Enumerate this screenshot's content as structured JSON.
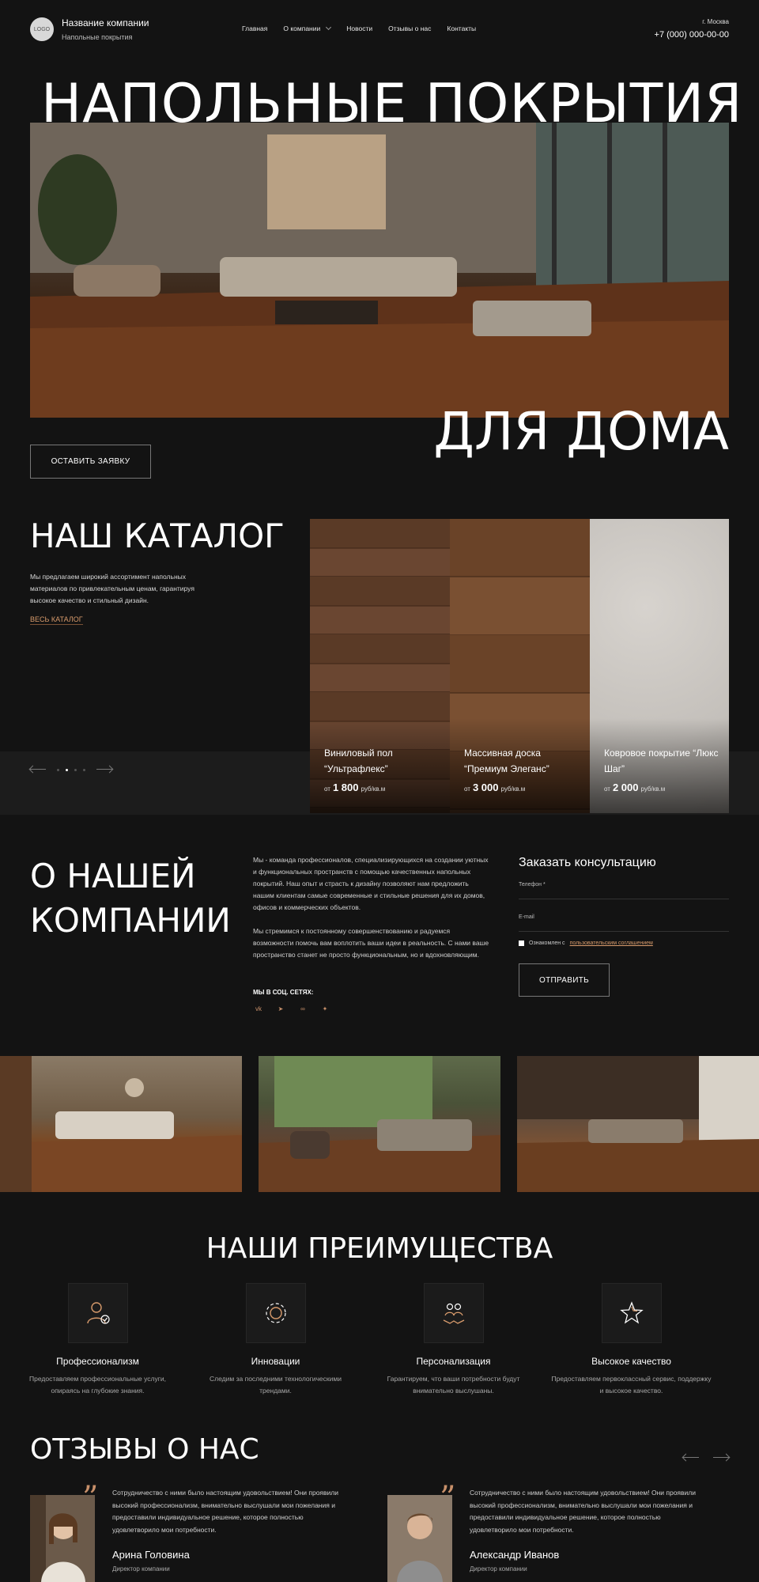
{
  "header": {
    "logo_text": "LOGO",
    "company_name": "Название компании",
    "company_sub": "Напольные покрытия",
    "nav": [
      "Главная",
      "О компании",
      "Новости",
      "Отзывы о нас",
      "Контакты"
    ],
    "city": "г. Москва",
    "phone": "+7 (000) 000-00-00"
  },
  "hero": {
    "title_line1": "НАПОЛЬНЫЕ ПОКРЫТИЯ",
    "title_line2": "ДЛЯ ДОМА",
    "button": "ОСТАВИТЬ ЗАЯВКУ"
  },
  "catalog": {
    "title": "НАШ КАТАЛОГ",
    "description": "Мы предлагаем широкий ассортимент напольных материалов по привлекательным ценам, гарантируя высокое качество и стильный дизайн.",
    "link": "ВЕСЬ КАТАЛОГ",
    "items": [
      {
        "name": "Виниловый пол “Ультрафлекс”",
        "price_prefix": "от",
        "price": "1 800",
        "unit": "руб/кв.м"
      },
      {
        "name": "Массивная доска “Премиум Элеганс”",
        "price_prefix": "от",
        "price": "3 000",
        "unit": "руб/кв.м"
      },
      {
        "name": "Ковровое покрытие “Люкс Шаг”",
        "price_prefix": "от",
        "price": "2 000",
        "unit": "руб/кв.м"
      }
    ]
  },
  "about": {
    "title": "О НАШЕЙ КОМПАНИИ",
    "paragraph1": "Мы - команда профессионалов, специализирующихся на создании уютных и функциональных пространств с помощью качественных напольных покрытий. Наш опыт и страсть к дизайну позволяют нам предложить нашим клиентам самые современные и стильные решения для их домов, офисов и коммерческих объектов.",
    "paragraph2": "Мы стремимся к постоянному совершенствованию и радуемся возможности помочь вам воплотить ваши идеи в реальность. С нами ваше пространство станет не просто функциональным, но и вдохновляющим.",
    "social_label": "МЫ В СОЦ. СЕТЯХ:",
    "socials": [
      "vk-icon",
      "telegram-icon",
      "odnoklassniki-icon",
      "twitter-icon"
    ]
  },
  "form": {
    "title": "Заказать консультацию",
    "phone_label": "Телефон *",
    "email_label": "E-mail",
    "agree_text": "Ознакомлен с",
    "agree_link": "пользовательским соглашением",
    "button": "ОТПРАВИТЬ"
  },
  "advantages": {
    "title": "НАШИ ПРЕИМУЩЕСТВА",
    "items": [
      {
        "icon": "professional-icon",
        "title": "Профессионализм",
        "desc": "Предоставляем профессиональные услуги, опираясь на глубокие знания."
      },
      {
        "icon": "gear-icon",
        "title": "Инновации",
        "desc": "Следим за последними технологическими трендами."
      },
      {
        "icon": "hands-people-icon",
        "title": "Персонализация",
        "desc": "Гарантируем, что ваши потребности будут внимательно выслушаны."
      },
      {
        "icon": "star-icon",
        "title": "Высокое качество",
        "desc": "Предоставляем первоклассный сервис, поддержку и высокое качество."
      }
    ]
  },
  "reviews": {
    "title": "ОТЗЫВЫ О НАС",
    "items": [
      {
        "text": "Сотрудничество с ними было настоящим удовольствием! Они проявили высокий профессионализм, внимательно выслушали мои пожелания и предоставили индивидуальное решение, которое полностью удовлетворило мои потребности.",
        "name": "Арина Головина",
        "role": "Директор компании"
      },
      {
        "text": "Сотрудничество с ними было настоящим удовольствием! Они проявили высокий профессионализм, внимательно выслушали мои пожелания и предоставили индивидуальное решение, которое полностью удовлетворило мои потребности.",
        "name": "Александр Иванов",
        "role": "Директор компании"
      }
    ]
  },
  "colors": {
    "background": "#131313",
    "accent": "#d89b6c"
  }
}
